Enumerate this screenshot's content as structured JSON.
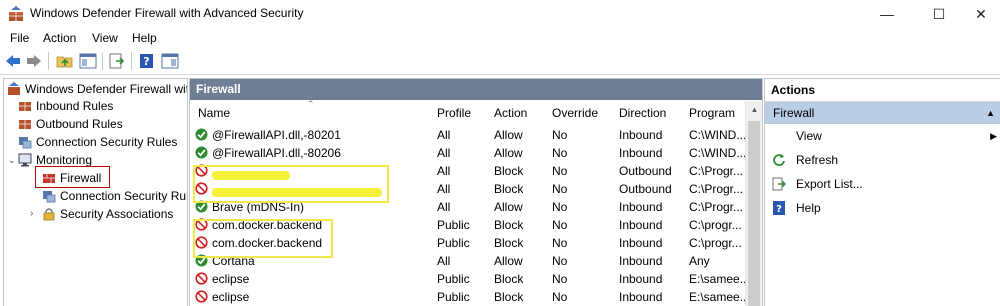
{
  "window": {
    "title": "Windows Defender Firewall with Advanced Security",
    "minimize": "—",
    "maximize": "☐",
    "close": "✕"
  },
  "menu": [
    "File",
    "Action",
    "View",
    "Help"
  ],
  "tree": {
    "root": "Windows Defender Firewall with",
    "items": [
      {
        "label": "Inbound Rules"
      },
      {
        "label": "Outbound Rules"
      },
      {
        "label": "Connection Security Rules"
      },
      {
        "label": "Monitoring"
      },
      {
        "label": "Firewall"
      },
      {
        "label": "Connection Security Rul"
      },
      {
        "label": "Security Associations"
      }
    ]
  },
  "center": {
    "header": "Firewall",
    "columns": [
      "Name",
      "Profile",
      "Action",
      "Override",
      "Direction",
      "Program"
    ],
    "rows": [
      {
        "name": "@FirewallAPI.dll,-80201",
        "profile": "All",
        "action": "Allow",
        "override": "No",
        "direction": "Inbound",
        "program": "C:\\WIND...",
        "status": "allow"
      },
      {
        "name": "@FirewallAPI.dll,-80206",
        "profile": "All",
        "action": "Allow",
        "override": "No",
        "direction": "Inbound",
        "program": "C:\\WIND...",
        "status": "allow"
      },
      {
        "name": "",
        "profile": "All",
        "action": "Block",
        "override": "No",
        "direction": "Outbound",
        "program": "C:\\Progr...",
        "status": "block"
      },
      {
        "name": "",
        "profile": "All",
        "action": "Block",
        "override": "No",
        "direction": "Outbound",
        "program": "C:\\Progr...",
        "status": "block"
      },
      {
        "name": "Brave (mDNS-In)",
        "profile": "All",
        "action": "Allow",
        "override": "No",
        "direction": "Inbound",
        "program": "C:\\Progr...",
        "status": "allow"
      },
      {
        "name": "com.docker.backend",
        "profile": "Public",
        "action": "Block",
        "override": "No",
        "direction": "Inbound",
        "program": "C:\\progr...",
        "status": "block"
      },
      {
        "name": "com.docker.backend",
        "profile": "Public",
        "action": "Block",
        "override": "No",
        "direction": "Inbound",
        "program": "C:\\progr...",
        "status": "block"
      },
      {
        "name": "Cortana",
        "profile": "All",
        "action": "Allow",
        "override": "No",
        "direction": "Inbound",
        "program": "Any",
        "status": "allow"
      },
      {
        "name": "eclipse",
        "profile": "Public",
        "action": "Block",
        "override": "No",
        "direction": "Inbound",
        "program": "E:\\samee...",
        "status": "block"
      },
      {
        "name": "eclipse",
        "profile": "Public",
        "action": "Block",
        "override": "No",
        "direction": "Inbound",
        "program": "E:\\samee...",
        "status": "block"
      }
    ]
  },
  "actions": {
    "header": "Actions",
    "section": "Firewall",
    "items": [
      "View",
      "Refresh",
      "Export List...",
      "Help"
    ]
  },
  "colors": {
    "pane_header": "#6e7f95",
    "section_highlight": "#b9cde5",
    "allow": "#2e8b2e",
    "block": "#d02020",
    "highlight_box": "#f5e84b",
    "selection_box": "#c00000"
  }
}
